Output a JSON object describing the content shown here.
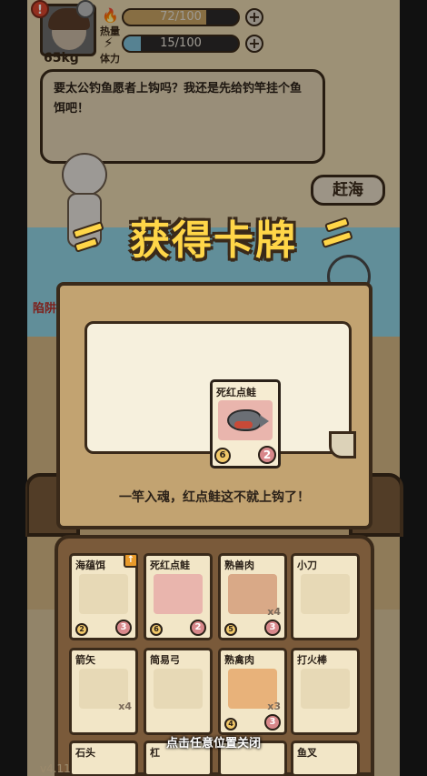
{
  "hud": {
    "weight": "65kg",
    "alert_badge": "!",
    "stats": [
      {
        "label": "热量",
        "icon": "🔥",
        "value_text": "72/100",
        "fraction": 0.72,
        "color": "#c8a363"
      },
      {
        "label": "体力",
        "icon": "⚡",
        "value_text": "15/100",
        "fraction": 0.15,
        "color": "#7fc0d8"
      }
    ],
    "plus": "+"
  },
  "speech": {
    "text": "要太公钓鱼愿者上钩吗？我还是先给钓竿挂个鱼饵吧！"
  },
  "side_button": {
    "label": "赶海"
  },
  "side_left_text": "陷阱",
  "banner": {
    "title": "获得卡牌"
  },
  "reward": {
    "card": {
      "name": "死红点鲑",
      "left_value": "6",
      "right_value": "2"
    },
    "message": "一竿入魂，红点鲑这不就上钩了！"
  },
  "inventory": {
    "new_tag": "↑",
    "slots": [
      {
        "name": "海蕴饵",
        "qty": "",
        "left": "2",
        "right": "3"
      },
      {
        "name": "死红点鲑",
        "qty": "",
        "left": "6",
        "right": "2"
      },
      {
        "name": "熟兽肉",
        "qty": "x4",
        "left": "5",
        "right": "3"
      },
      {
        "name": "小刀",
        "qty": "",
        "left": "",
        "right": ""
      },
      {
        "name": "箭矢",
        "qty": "x4",
        "left": "",
        "right": ""
      },
      {
        "name": "简易弓",
        "qty": "",
        "left": "",
        "right": ""
      },
      {
        "name": "熟禽肉",
        "qty": "x3",
        "left": "4",
        "right": "3"
      },
      {
        "name": "打火棒",
        "qty": "",
        "left": "",
        "right": ""
      }
    ],
    "partial_row": [
      "石头",
      "杠",
      "",
      "鱼叉"
    ]
  },
  "close_hint": "点击任意位置关闭",
  "version": "v4.11"
}
